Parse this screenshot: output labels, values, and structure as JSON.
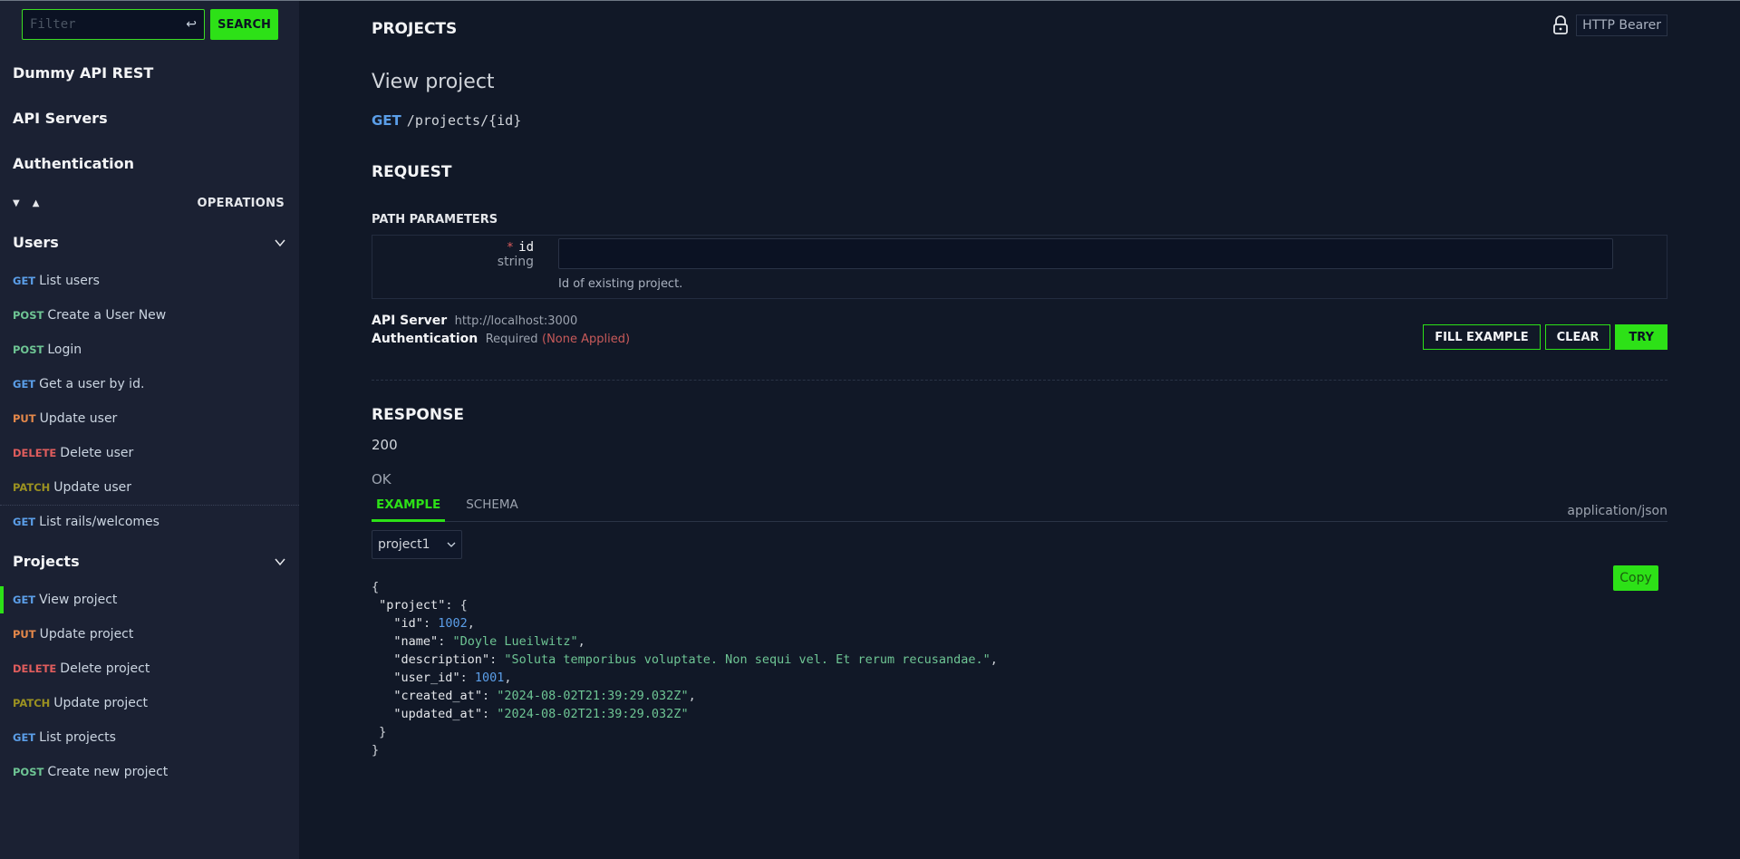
{
  "sidebar": {
    "filter": {
      "placeholder": "Filter",
      "value": ""
    },
    "search_label": "SEARCH",
    "nav": [
      "Dummy API REST",
      "API Servers",
      "Authentication"
    ],
    "operations_label": "OPERATIONS",
    "groups": [
      {
        "title": "Users",
        "items": [
          {
            "method": "GET",
            "label": "List users"
          },
          {
            "method": "POST",
            "label": "Create a User New"
          },
          {
            "method": "POST",
            "label": "Login"
          },
          {
            "method": "GET",
            "label": "Get a user by id."
          },
          {
            "method": "PUT",
            "label": "Update user"
          },
          {
            "method": "DELETE",
            "label": "Delete user"
          },
          {
            "method": "PATCH",
            "label": "Update user"
          }
        ]
      },
      {
        "title": "",
        "items": [
          {
            "method": "GET",
            "label": "List rails/welcomes"
          }
        ]
      },
      {
        "title": "Projects",
        "items": [
          {
            "method": "GET",
            "label": "View project",
            "selected": true
          },
          {
            "method": "PUT",
            "label": "Update project"
          },
          {
            "method": "DELETE",
            "label": "Delete project"
          },
          {
            "method": "PATCH",
            "label": "Update project"
          },
          {
            "method": "GET",
            "label": "List projects"
          },
          {
            "method": "POST",
            "label": "Create new project"
          }
        ]
      }
    ]
  },
  "main": {
    "section": "PROJECTS",
    "auth_badge": "HTTP Bearer",
    "op_title": "View project",
    "method": "GET",
    "path": "/projects/{id}",
    "request_title": "REQUEST",
    "path_params_title": "PATH PARAMETERS",
    "param": {
      "required_mark": "*",
      "name": "id",
      "type": "string",
      "value": "",
      "description": "Id of existing project."
    },
    "api_server_label": "API Server",
    "api_server_value": "http://localhost:3000",
    "auth_label": "Authentication",
    "auth_value": "Required",
    "auth_status": "(None Applied)",
    "buttons": {
      "fill_example": "FILL EXAMPLE",
      "clear": "CLEAR",
      "try": "TRY"
    },
    "response_title": "RESPONSE",
    "status_code": "200",
    "status_text": "OK",
    "tabs": [
      {
        "label": "EXAMPLE",
        "active": true
      },
      {
        "label": "SCHEMA",
        "active": false
      }
    ],
    "mime": "application/json",
    "example_select": "project1",
    "copy_label": "Copy",
    "example": {
      "root_key": "project",
      "fields": [
        {
          "key": "id",
          "value": "1002",
          "type": "number"
        },
        {
          "key": "name",
          "value": "Doyle Lueilwitz",
          "type": "string"
        },
        {
          "key": "description",
          "value": "Soluta temporibus voluptate. Non sequi vel. Et rerum recusandae.",
          "type": "string"
        },
        {
          "key": "user_id",
          "value": "1001",
          "type": "number"
        },
        {
          "key": "created_at",
          "value": "2024-08-02T21:39:29.032Z",
          "type": "string"
        },
        {
          "key": "updated_at",
          "value": "2024-08-02T21:39:29.032Z",
          "type": "string"
        }
      ]
    }
  },
  "colors": {
    "accent": "#2de117",
    "sidebar_bg": "#1b2133",
    "main_bg": "#111827",
    "GET": "#5b9ee8",
    "POST": "#6ec594",
    "PUT": "#e5884a",
    "DELETE": "#e05d5d",
    "PATCH": "#9b9121"
  }
}
